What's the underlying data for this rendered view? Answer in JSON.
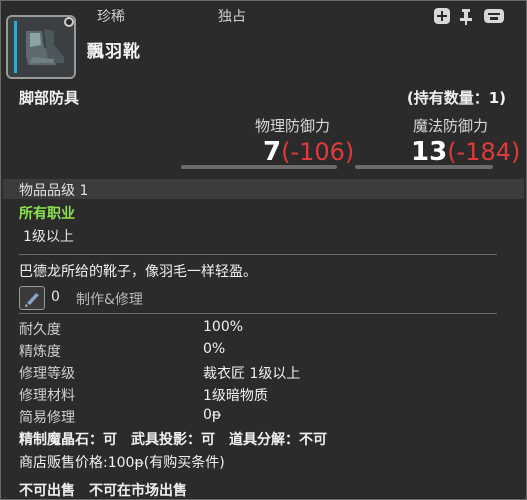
{
  "header": {
    "tag_rare": "珍稀",
    "tag_unique": "独占",
    "controls": [
      "plus-icon",
      "pin-icon",
      "storage-icon"
    ]
  },
  "item": {
    "name": "飄羽靴",
    "category": "脚部防具",
    "owned_label": "(持有数量：1)"
  },
  "stats": {
    "physical": {
      "label": "物理防御力",
      "value": "7",
      "diff": "(-106)"
    },
    "magic": {
      "label": "魔法防御力",
      "value": "13",
      "diff": "(-184)"
    }
  },
  "item_level": "物品品级 1",
  "jobs": "所有职业",
  "level_requirement": "1级以上",
  "description": "巴德龙所给的靴子，像羽毛一样轻盈。",
  "crafting": {
    "count": "0",
    "label": "制作&修理"
  },
  "details": [
    {
      "key": "耐久度",
      "value": "100%"
    },
    {
      "key": "精炼度",
      "value": "0%"
    },
    {
      "key": "修理等级",
      "value": "裁衣匠 1级以上"
    },
    {
      "key": "修理材料",
      "value": "1级暗物质"
    },
    {
      "key": "简易修理",
      "value": "0ᵽ"
    }
  ],
  "properties_line": "精制魔晶石：可　武具投影：可　道具分解：不可",
  "shop_price": "商店贩售价格:100ᵽ(有购买条件)",
  "market_line": "不可出售　不可在市场出售",
  "colors": {
    "background": "#2b2b2b",
    "jobs_green": "#8de24f",
    "diff_red": "#e03a3a",
    "accent_blue": "#3aa7c7"
  }
}
